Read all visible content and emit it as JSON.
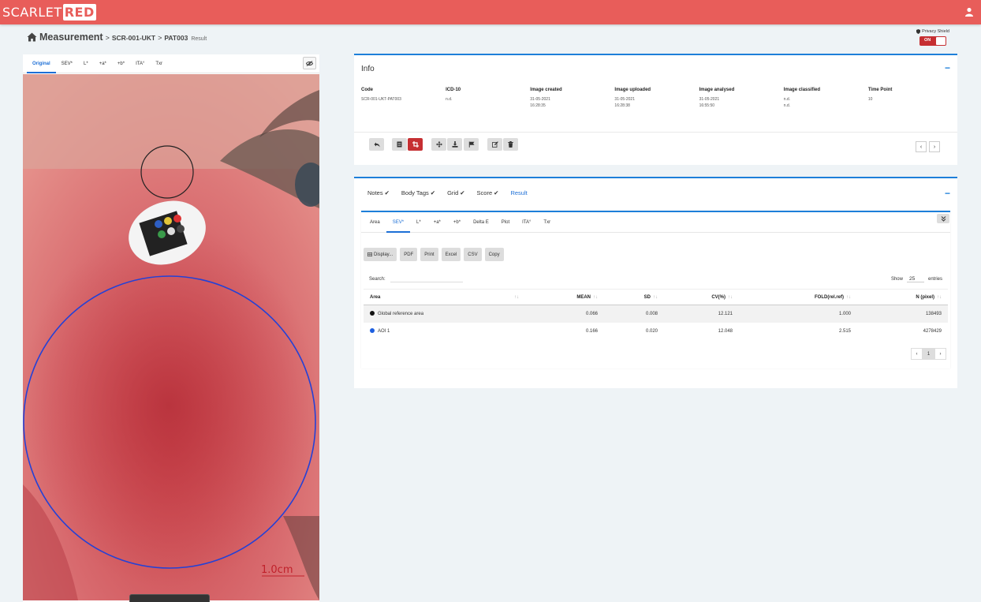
{
  "app": {
    "logo_part1": "SCARLET",
    "logo_part2": "RED"
  },
  "breadcrumb": {
    "title": "Measurement",
    "sep1": ">",
    "study": "SCR-001-UKT",
    "sep2": ">",
    "patient": "PAT003",
    "page": "Result"
  },
  "privacy": {
    "label": "Privacy Shield",
    "state": "ON"
  },
  "image_tabs": [
    "Original",
    "SEV*",
    "L*",
    "+a*",
    "+b*",
    "ITA°",
    "Txr"
  ],
  "image": {
    "scale_label": "1.0cm"
  },
  "info": {
    "title": "Info",
    "collapse": "−",
    "columns": [
      {
        "h": "Code",
        "v": "SCR-001-UKT-PAT003"
      },
      {
        "h": "ICD-10",
        "v": "n.d."
      },
      {
        "h": "Image created",
        "v": "31-05-2021\n16:28:35"
      },
      {
        "h": "Image uploaded",
        "v": "31-05-2021\n16:28:38"
      },
      {
        "h": "Image analysed",
        "v": "31-05-2021\n16:55:50"
      },
      {
        "h": "Image classified",
        "v": "n.d.\nn.d."
      },
      {
        "h": "Time Point",
        "v": "10"
      }
    ],
    "prev": "‹",
    "next": "›"
  },
  "result": {
    "collapse": "−",
    "tabs": [
      {
        "label": "Notes",
        "check": "✔"
      },
      {
        "label": "Body Tags",
        "check": "✔"
      },
      {
        "label": "Grid",
        "check": "✔"
      },
      {
        "label": "Score",
        "check": "✔"
      },
      {
        "label": "Result",
        "check": ""
      }
    ],
    "subtabs": [
      "Area",
      "SEV*",
      "L*",
      "+a*",
      "+b*",
      "Delta E",
      "Plot",
      "ITA°",
      "Txr"
    ],
    "export_buttons": [
      "Display...",
      "PDF",
      "Print",
      "Excel",
      "CSV",
      "Copy"
    ],
    "search_label": "Search:",
    "show_label": "Show",
    "show_value": "25",
    "entries_label": "entries",
    "columns": [
      "Area",
      "MEAN",
      "SD",
      "CV(%)",
      "FOLD(rel.ref)",
      "N (pixel)"
    ],
    "rows": [
      {
        "area": "Global reference area",
        "color": "#111111",
        "mean": "0.066",
        "sd": "0.008",
        "cv": "12.121",
        "fold": "1.000",
        "n": "138493"
      },
      {
        "area": "AOI 1",
        "color": "#1d5fe0",
        "mean": "0.166",
        "sd": "0.020",
        "cv": "12.048",
        "fold": "2.515",
        "n": "4278429"
      }
    ],
    "pager": {
      "prev": "‹",
      "page": "1",
      "next": "›"
    }
  },
  "colors": {
    "brand": "#e85d5a",
    "accent": "#1d7fd9",
    "danger": "#c62f32"
  }
}
